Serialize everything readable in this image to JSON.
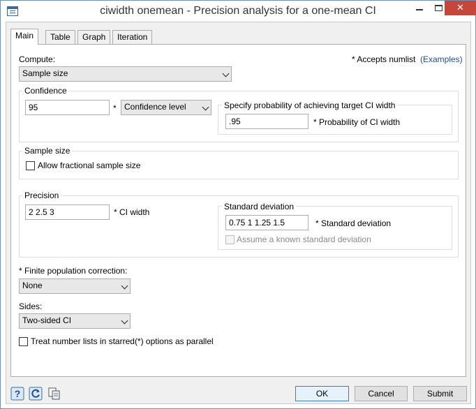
{
  "window": {
    "title": "ciwidth onemean - Precision analysis for a one-mean CI"
  },
  "tabs": [
    {
      "label": "Main",
      "active": true
    },
    {
      "label": "Table",
      "active": false
    },
    {
      "label": "Graph",
      "active": false
    },
    {
      "label": "Iteration",
      "active": false
    }
  ],
  "main": {
    "compute_label": "Compute:",
    "compute_value": "Sample size",
    "numlist_note": "* Accepts numlist",
    "examples_link": "(Examples)",
    "confidence": {
      "title": "Confidence",
      "value": "95",
      "star": "*",
      "level_select": "Confidence level",
      "prob_group_title": "Specify probability of achieving target CI width",
      "prob_value": ".95",
      "prob_label": "* Probability of CI width"
    },
    "sample_size": {
      "title": "Sample size",
      "fractional_label": "Allow fractional sample size",
      "fractional_checked": false
    },
    "precision": {
      "title": "Precision",
      "width_value": "2 2.5 3",
      "width_label": "* CI width",
      "sd_group_title": "Standard deviation",
      "sd_value": "0.75 1 1.25 1.5",
      "sd_label": "* Standard deviation",
      "known_sd_label": "Assume a known standard deviation",
      "known_sd_checked": false
    },
    "fpc_label": "* Finite population correction:",
    "fpc_value": "None",
    "sides_label": "Sides:",
    "sides_value": "Two-sided CI",
    "parallel_label": "Treat number lists in starred(*) options as parallel",
    "parallel_checked": false
  },
  "footer": {
    "ok_label": "OK",
    "cancel_label": "Cancel",
    "submit_label": "Submit"
  },
  "colors": {
    "link": "#1a4f99",
    "close_button": "#c7463b",
    "default_button_border": "#3c7fb1"
  }
}
